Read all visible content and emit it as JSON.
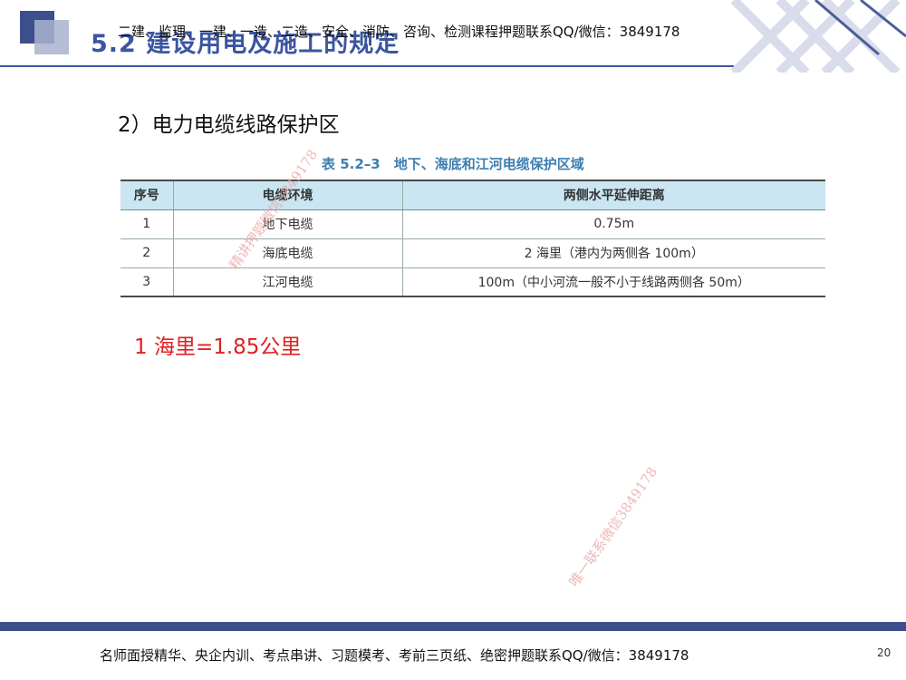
{
  "header": {
    "title": "5.2 建设用电及施工的规定",
    "overlay_text": "二建、监理、一建、一造、二造、安全、消防、咨询、检测课程押题联系QQ/微信：3849178"
  },
  "subheading": "2）电力电缆线路保护区",
  "table": {
    "caption": "表 5.2–3　地下、海底和江河电缆保护区域",
    "columns": [
      "序号",
      "电缆环境",
      "两侧水平延伸距离"
    ],
    "rows": [
      [
        "1",
        "地下电缆",
        "0.75m"
      ],
      [
        "2",
        "海底电缆",
        "2 海里（港内为两侧各 100m）"
      ],
      [
        "3",
        "江河电缆",
        "100m（中小河流一般不小于线路两侧各 50m）"
      ]
    ]
  },
  "note": "1 海里=1.85公里",
  "watermarks": [
    "精讲押题微信3849178",
    "唯一联系微信3849178"
  ],
  "footer": {
    "text": "名师面授精华、央企内训、考点串讲、习题模考、考前三页纸、绝密押题联系QQ/微信：3849178",
    "page_number": "20"
  },
  "colors": {
    "title": "#3b55a0",
    "header_square": "#3c4f8c",
    "table_header_bg": "#c9e6f2",
    "note": "#e02020",
    "footer_bar": "#3d4f8a"
  }
}
